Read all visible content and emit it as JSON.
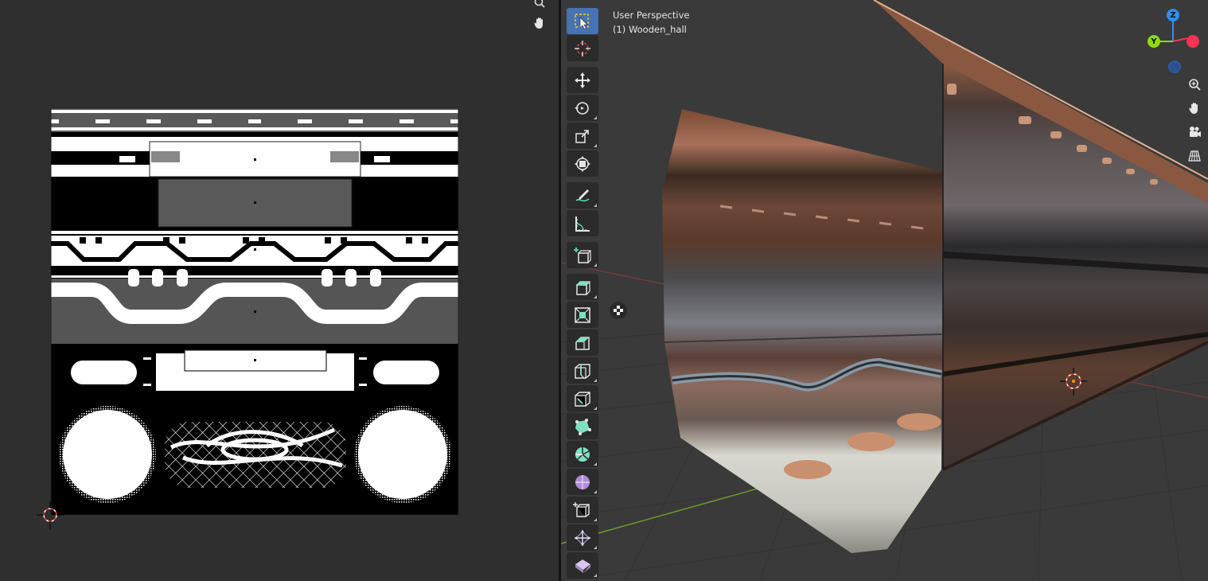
{
  "viewport": {
    "perspective_label": "User Perspective",
    "object_label": "(1) Wooden_hall"
  },
  "gizmo": {
    "z_label": "Z",
    "y_label": "Y",
    "x_color": "#ff3352",
    "y_color": "#8bdc00",
    "z_color": "#2890ff"
  },
  "toolbar": {
    "tools": [
      "select-box",
      "cursor",
      "move",
      "rotate",
      "scale",
      "transform",
      "annotate",
      "measure",
      "add-cube",
      "extrude-region",
      "inset-faces",
      "bevel",
      "loop-cut",
      "knife",
      "poly-build",
      "spin",
      "smooth",
      "edge-slide",
      "shrink-fatten",
      "shear"
    ],
    "active_tool": "select-box"
  },
  "colors": {
    "editor_bg": "#2f2f2f",
    "viewport_bg": "#3a3a3a",
    "accent": "#4772b3",
    "grid_x_axis": "#b53a3a",
    "grid_y_axis": "#6a9a2a"
  }
}
